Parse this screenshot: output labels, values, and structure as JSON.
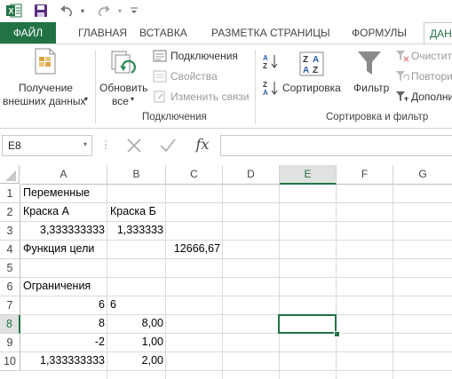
{
  "qat": {
    "icons": [
      "excel-app-icon",
      "save-icon",
      "undo-icon",
      "redo-icon",
      "customize-icon"
    ]
  },
  "tabs": [
    "ФАЙЛ",
    "ГЛАВНАЯ",
    "ВСТАВКА",
    "РАЗМЕТКА СТРАНИЦЫ",
    "ФОРМУЛЫ",
    "ДАН"
  ],
  "ribbon": {
    "get_external_line1": "Получение",
    "get_external_line2": "внешних данных",
    "refresh_line1": "Обновить",
    "refresh_line2": "все",
    "connections": "Подключения",
    "properties": "Свойства",
    "edit_links": "Изменить связи",
    "group_connections": "Подключения",
    "sort": "Сортировка",
    "filter": "Фильтр",
    "clear": "Очистит",
    "reapply": "Повтори",
    "advanced": "Дополни",
    "group_sort_filter": "Сортировка и фильтр"
  },
  "formula_bar": {
    "name_box": "E8",
    "fx": "fx",
    "formula": ""
  },
  "columns": [
    "A",
    "B",
    "C",
    "D",
    "E",
    "F",
    "G"
  ],
  "rows": [
    "1",
    "2",
    "3",
    "4",
    "5",
    "6",
    "7",
    "8",
    "9",
    "10"
  ],
  "selected_cell": "E8",
  "cells": {
    "A1": "Переменные",
    "A2": "Краска А",
    "B2": "Краска Б",
    "A3": "3,333333333",
    "B3": "1,333333",
    "A4": "Функция цели",
    "C4": "12666,67",
    "A6": "Ограничения",
    "A7": "6",
    "B7": "6",
    "A8": "8",
    "B8": "8,00",
    "A9": "-2",
    "B9": "1,00",
    "A10": "1,333333333",
    "B10": "2,00"
  },
  "colors": {
    "accent": "#217346",
    "selection": "#217346"
  }
}
